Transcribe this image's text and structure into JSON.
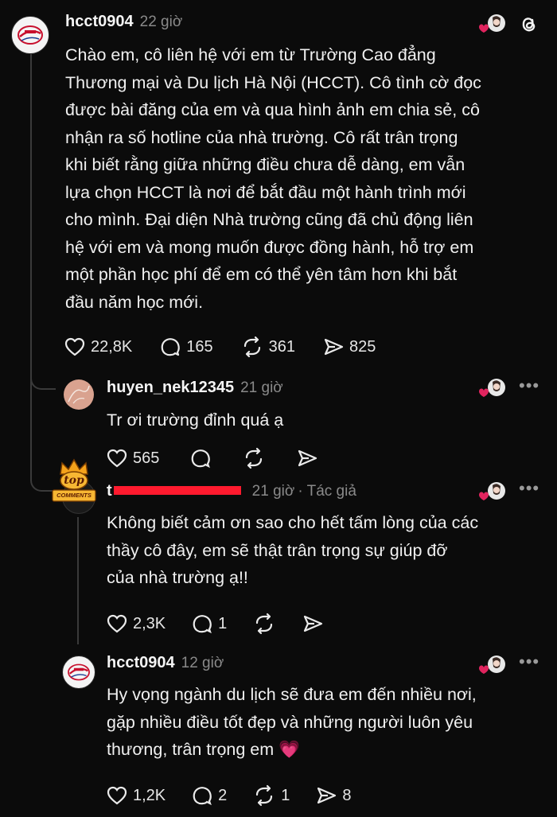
{
  "post": {
    "username": "hcct0904",
    "time": "22 giờ",
    "lines": [
      "Chào em, cô liên hệ với em từ Trường Cao đẳng",
      "Thương mại và Du lịch Hà Nội (HCCT). Cô tình cờ đọc",
      "được bài đăng của em và qua hình ảnh em chia sẻ, cô",
      "nhận ra số hotline của nhà trường. Cô rất trân trọng",
      "khi biết rằng giữa những điều chưa dễ dàng, em vẫn",
      "lựa chọn HCCT là nơi để bắt đầu một hành trình mới",
      "cho mình. Đại diện Nhà trường cũng đã chủ động liên",
      "hệ với em và mong muốn được đồng hành, hỗ trợ em",
      "một phần học phí để em có thể yên tâm hơn khi bắt",
      "đầu năm học mới."
    ],
    "likes": "22,8K",
    "replies": "165",
    "reposts": "361",
    "shares": "825"
  },
  "reply1": {
    "username": "huyen_nek12345",
    "time": "21 giờ",
    "text": "Tr ơi trường đỉnh quá ạ",
    "likes": "565"
  },
  "reply2": {
    "username_visible": "t",
    "username_tail": "",
    "time": "21 giờ",
    "author_tag": "· Tác giả",
    "badge_line1": "top",
    "badge_line2": "COMMENTS",
    "lines": [
      "Không biết cảm ơn sao cho hết tấm lòng của các",
      "thầy cô đây, em sẽ thật trân trọng sự giúp đỡ",
      "của nhà trường ạ!!"
    ],
    "likes": "2,3K",
    "replies": "1"
  },
  "reply3": {
    "username": "hcct0904",
    "time": "12 giờ",
    "lines": [
      "Hy vọng ngành du lịch sẽ đưa em đến nhiều nơi,",
      "gặp nhiều điều tốt đẹp và những người luôn yêu",
      "thương, trân trọng em"
    ],
    "emoji": "💗",
    "likes": "1,2K",
    "replies": "2",
    "reposts": "1",
    "shares": "8"
  },
  "icons": {
    "like": "heart-icon",
    "reply": "comment-icon",
    "repost": "repost-icon",
    "share": "send-icon",
    "more": "more-icon",
    "threads": "threads-logo-icon"
  },
  "colors": {
    "background": "#0b0b0b",
    "accent_red": "#e0245e",
    "muted": "#8a8a8a"
  }
}
